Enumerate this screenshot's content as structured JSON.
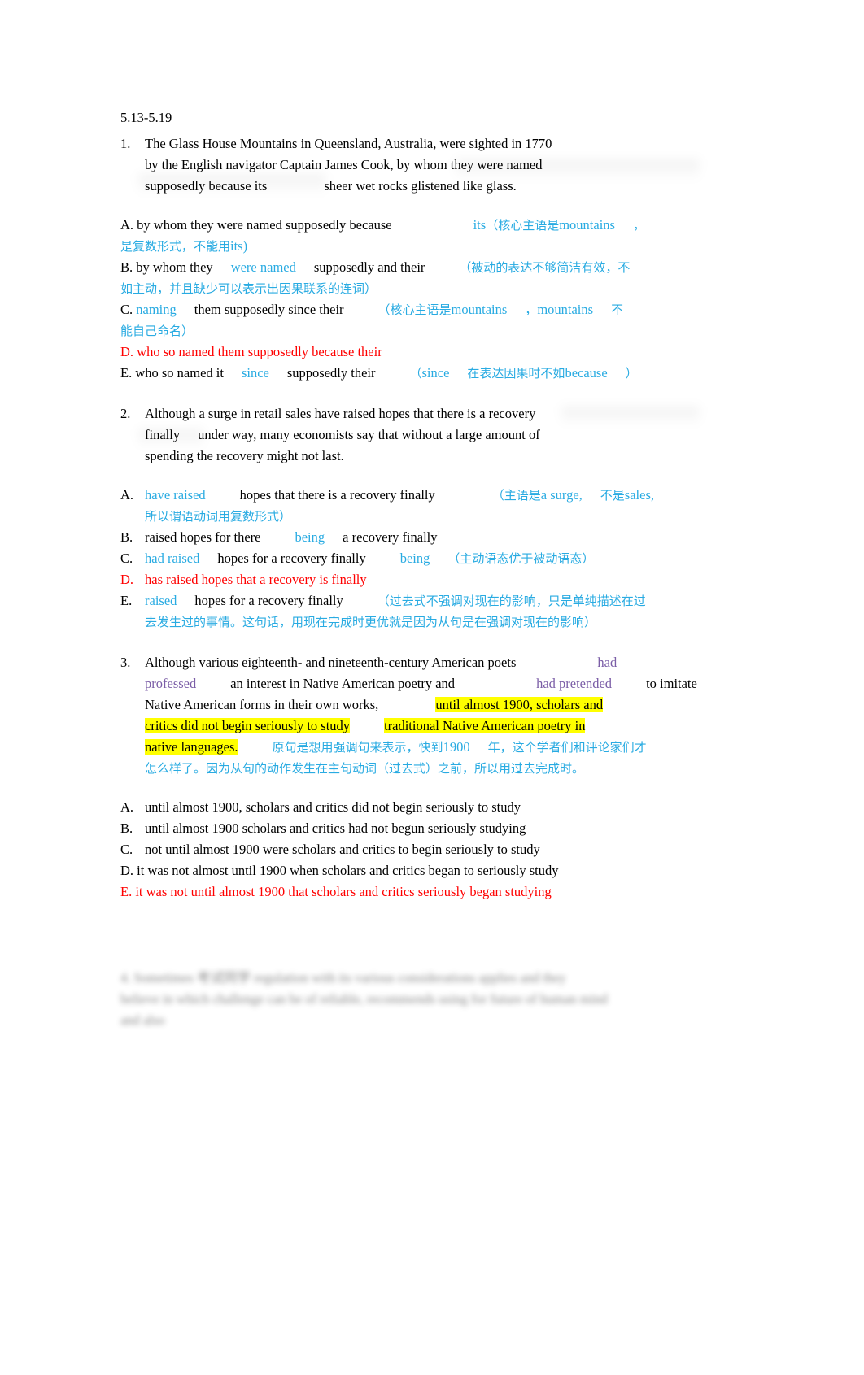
{
  "document": {
    "date_range": "5.13-5.19"
  },
  "questions": [
    {
      "number": "1.",
      "stem_lines": [
        "The Glass House Mountains in Queensland, Australia, were sighted in 1770",
        "by the English navigator Captain James Cook, by whom they were named",
        "supposedly because its"
      ],
      "stem_tail": "sheer wet rocks glistened like glass.",
      "options": [
        {
          "label": "A.",
          "parts": [
            {
              "text": "by whom they were named supposedly because",
              "style": "plain"
            }
          ],
          "note_parts": [
            {
              "text": "its",
              "style": "en-blue"
            },
            {
              "text": "（核心主语是",
              "style": "cn"
            },
            {
              "text": "mountains",
              "style": "en-blue"
            },
            {
              "text": "，",
              "style": "cn"
            }
          ],
          "note_cont_parts": [
            {
              "text": "是复数形式，不能用",
              "style": "cn"
            },
            {
              "text": "its)",
              "style": "en-blue"
            }
          ]
        },
        {
          "label": "B.",
          "parts": [
            {
              "text": "by whom they",
              "style": "plain"
            },
            {
              "text": "were named",
              "style": "en-blue"
            },
            {
              "text": "supposedly and their",
              "style": "plain"
            }
          ],
          "note_parts": [
            {
              "text": "（被动的表达不够简洁有效，不",
              "style": "cn"
            }
          ],
          "note_cont_parts": [
            {
              "text": "如主动，并且缺少可以表示出因果联系的连词）",
              "style": "cn"
            }
          ]
        },
        {
          "label": "C.",
          "parts": [
            {
              "text": "naming",
              "style": "en-blue"
            },
            {
              "text": "them supposedly since their",
              "style": "plain"
            }
          ],
          "note_parts": [
            {
              "text": "（核心主语是",
              "style": "cn"
            },
            {
              "text": "mountains",
              "style": "en-blue"
            },
            {
              "text": "，",
              "style": "cn"
            },
            {
              "text": "mountains",
              "style": "en-blue"
            },
            {
              "text": "不",
              "style": "cn"
            }
          ],
          "note_cont_parts": [
            {
              "text": "能自己命名）",
              "style": "cn"
            }
          ]
        },
        {
          "label": "D.",
          "parts": [
            {
              "text": "who so named them supposedly because their",
              "style": "red"
            }
          ],
          "note_parts": [],
          "note_cont_parts": []
        },
        {
          "label": "E.",
          "parts": [
            {
              "text": "who so named it",
              "style": "plain"
            },
            {
              "text": "since",
              "style": "en-blue"
            },
            {
              "text": "supposedly their",
              "style": "plain"
            }
          ],
          "note_parts": [
            {
              "text": "（",
              "style": "cn"
            },
            {
              "text": "since",
              "style": "en-blue"
            },
            {
              "text": "在表达因果时不如",
              "style": "cn"
            },
            {
              "text": "because",
              "style": "en-blue"
            },
            {
              "text": "）",
              "style": "cn"
            }
          ],
          "note_cont_parts": []
        }
      ]
    },
    {
      "number": "2.",
      "stem_lines": [
        "Although a surge in retail sales have raised hopes that there is a recovery",
        "finally",
        "under way, many economists say that without a large amount of",
        "spending the recovery might not last."
      ],
      "options": [
        {
          "label": "A.",
          "parts": [
            {
              "text": "have raised",
              "style": "en-blue"
            },
            {
              "text": "hopes that there is a recovery finally",
              "style": "plain"
            }
          ],
          "note_parts": [
            {
              "text": "（主语是",
              "style": "cn"
            },
            {
              "text": "a surge,",
              "style": "en-blue"
            },
            {
              "text": "不是",
              "style": "cn"
            },
            {
              "text": "sales,",
              "style": "en-blue"
            }
          ],
          "note_cont_parts": [
            {
              "text": "所以谓语动词用复数形式）",
              "style": "cn"
            }
          ]
        },
        {
          "label": "B.",
          "parts": [
            {
              "text": "raised hopes for there",
              "style": "plain"
            },
            {
              "text": "being",
              "style": "en-blue"
            },
            {
              "text": "a recovery finally",
              "style": "plain"
            }
          ],
          "note_parts": [],
          "note_cont_parts": []
        },
        {
          "label": "C.",
          "parts": [
            {
              "text": "had raised",
              "style": "en-blue"
            },
            {
              "text": "hopes for a recovery finally",
              "style": "plain"
            },
            {
              "text": "being",
              "style": "en-blue"
            }
          ],
          "note_parts": [
            {
              "text": "（主动语态优于被动语态）",
              "style": "cn"
            }
          ],
          "note_cont_parts": []
        },
        {
          "label": "D.",
          "parts": [
            {
              "text": "has raised hopes that a recovery is finally",
              "style": "red"
            }
          ],
          "note_parts": [],
          "note_cont_parts": []
        },
        {
          "label": "E.",
          "parts": [
            {
              "text": "raised",
              "style": "en-blue"
            },
            {
              "text": "hopes for a recovery finally",
              "style": "plain"
            }
          ],
          "note_parts": [
            {
              "text": "（过去式不强调对现在的影响，只是单纯描述在过",
              "style": "cn"
            }
          ],
          "note_cont_parts": [
            {
              "text": "去发生过的事情。这句话，用现在完成时更优就是因为从句是在强调对现在的影响）",
              "style": "cn"
            }
          ]
        }
      ]
    },
    {
      "number": "3.",
      "stem_segments": [
        {
          "text": "Although various eighteenth- and nineteenth-century American poets",
          "style": "plain"
        },
        {
          "text": "had",
          "style": "purple"
        },
        {
          "text": "professed",
          "style": "purple"
        },
        {
          "text": "an interest in Native American poetry and",
          "style": "plain"
        },
        {
          "text": "had pretended",
          "style": "purple"
        },
        {
          "text": "to imitate",
          "style": "plain"
        },
        {
          "text": "Native American forms in their own works,",
          "style": "plain"
        },
        {
          "text": "until almost 1900, scholars and",
          "style": "highlight"
        },
        {
          "text": "critics did not begin seriously to study",
          "style": "highlight"
        },
        {
          "text": "traditional Native American poetry in",
          "style": "highlight"
        },
        {
          "text": "native languages.",
          "style": "highlight"
        }
      ],
      "note_parts": [
        {
          "text": "原句是想用强调句来表示，快到",
          "style": "cn"
        },
        {
          "text": "1900",
          "style": "en-blue"
        },
        {
          "text": "年，这个学者们和评论家们才",
          "style": "cn"
        }
      ],
      "note_cont_parts": [
        {
          "text": "怎么样了。因为从句的动作发生在主句动词（过去式）之前，所以用过去完成时。",
          "style": "cn"
        }
      ],
      "options": [
        {
          "label": "A.",
          "text": "until almost 1900, scholars and critics did not begin seriously to study",
          "style": "plain"
        },
        {
          "label": "B.",
          "text": "until almost 1900 scholars and critics had not begun seriously studying",
          "style": "plain"
        },
        {
          "label": "C.",
          "text": "not until almost 1900 were scholars and critics to begin seriously to study",
          "style": "plain"
        },
        {
          "label": "D.",
          "text": " it was not almost until 1900 when scholars and critics began to seriously study",
          "style": "plain"
        },
        {
          "label": "E.",
          "text": "  it was not until almost 1900 that scholars and critics seriously began studying",
          "style": "red"
        }
      ]
    }
  ],
  "blurred_section": {
    "number": "4.",
    "lines": [
      "Sometimes    考试同学      regulation with its various considerations  applies and they",
      "believe in which challenge can be of reliable, recommends using for future of human mind",
      "and also"
    ]
  },
  "colors": {
    "annotation_blue": "#29abe2",
    "answer_red": "#ff0000",
    "emphasis_purple": "#7b5ea7",
    "highlight_yellow": "#ffff00"
  }
}
